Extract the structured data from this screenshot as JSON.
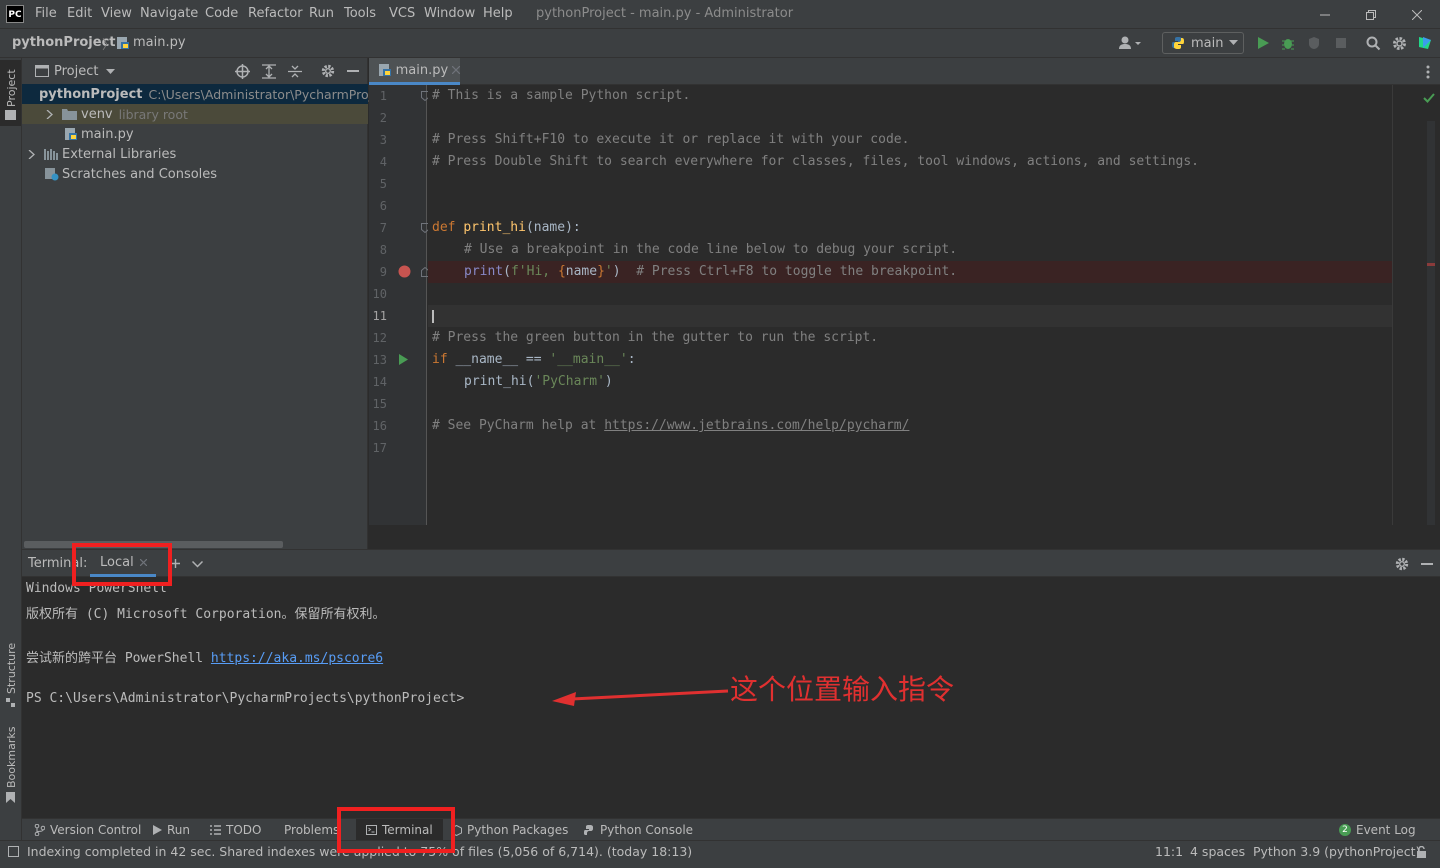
{
  "app": {
    "logo": "PC",
    "window_title": "pythonProject - main.py - Administrator"
  },
  "menu": [
    "File",
    "Edit",
    "View",
    "Navigate",
    "Code",
    "Refactor",
    "Run",
    "Tools",
    "VCS",
    "Window",
    "Help"
  ],
  "navbar": {
    "project": "pythonProject",
    "file": "main.py",
    "run_config": "main"
  },
  "left_stripe": {
    "project": "Project",
    "structure": "Structure",
    "bookmarks": "Bookmarks"
  },
  "project_panel": {
    "title": "Project",
    "tree": [
      {
        "name": "pythonProject",
        "hint": "C:\\Users\\Administrator\\PycharmProj",
        "icon": "folder-icon"
      },
      {
        "name": "venv",
        "hint": "library root",
        "icon": "folder-icon"
      },
      {
        "name": "main.py",
        "hint": "",
        "icon": "python-file-icon"
      },
      {
        "name": "External Libraries",
        "hint": "",
        "icon": "library-icon"
      },
      {
        "name": "Scratches and Consoles",
        "hint": "",
        "icon": "scratches-icon"
      }
    ]
  },
  "editor": {
    "tab": "main.py",
    "current_line": "11",
    "line_numbers": [
      "1",
      "2",
      "3",
      "4",
      "5",
      "6",
      "7",
      "8",
      "9",
      "10",
      "11",
      "12",
      "13",
      "14",
      "15",
      "16",
      "17"
    ]
  },
  "code_tokens": {
    "l1": "# This is a sample Python script.",
    "l3": "# Press Shift+F10 to execute it or replace it with your code.",
    "l4": "# Press Double Shift to search everywhere for classes, files, tool windows, actions, and settings.",
    "l7_kw": "def ",
    "l7_fn": "print_hi",
    "l7_rest": "(name):",
    "l8": "# Use a breakpoint in the code line below to debug your script.",
    "l9_fn": "print",
    "l9_p1": "(",
    "l9_s1": "f'Hi, ",
    "l9_b1": "{",
    "l9_name": "name",
    "l9_b2": "}",
    "l9_s2": "'",
    "l9_p2": ")  ",
    "l9_cm": "# Press Ctrl+F8 to toggle the breakpoint.",
    "l12": "# Press the green button in the gutter to run the script.",
    "l13_kw": "if ",
    "l13_a": "__name__ == ",
    "l13_s": "'__main__'",
    "l13_b": ":",
    "l14_a": "print_hi(",
    "l14_s": "'PyCharm'",
    "l14_b": ")",
    "l16_cm": "# See PyCharm help at ",
    "l16_link": "https://www.jetbrains.com/help/pycharm/"
  },
  "terminal": {
    "title": "Terminal:",
    "tab": "Local",
    "lines": [
      "Windows PowerShell",
      "版权所有 (C) Microsoft Corporation。保留所有权利。",
      "",
      "尝试新的跨平台 PowerShell ",
      "",
      "PS C:\\Users\\Administrator\\PycharmProjects\\pythonProject>"
    ],
    "link": "https://aka.ms/pscore6",
    "annotation": "这个位置输入指令"
  },
  "tool_windows": [
    "Version Control",
    "Run",
    "TODO",
    "Problems",
    "Terminal",
    "Python Packages",
    "Python Console"
  ],
  "event_log": {
    "count": "2",
    "label": "Event Log"
  },
  "status": {
    "message": "Indexing completed in 42 sec. Shared indexes were applied to 75% of files (5,056 of 6,714). (today 18:13)",
    "position": "11:1",
    "indent": "4 spaces",
    "interpreter": "Python 3.9 (pythonProject)"
  },
  "colors": {
    "accent": "#4a88c7",
    "annotation": "#f02020",
    "run_green": "#499c54",
    "breakpoint": "#c75450"
  }
}
